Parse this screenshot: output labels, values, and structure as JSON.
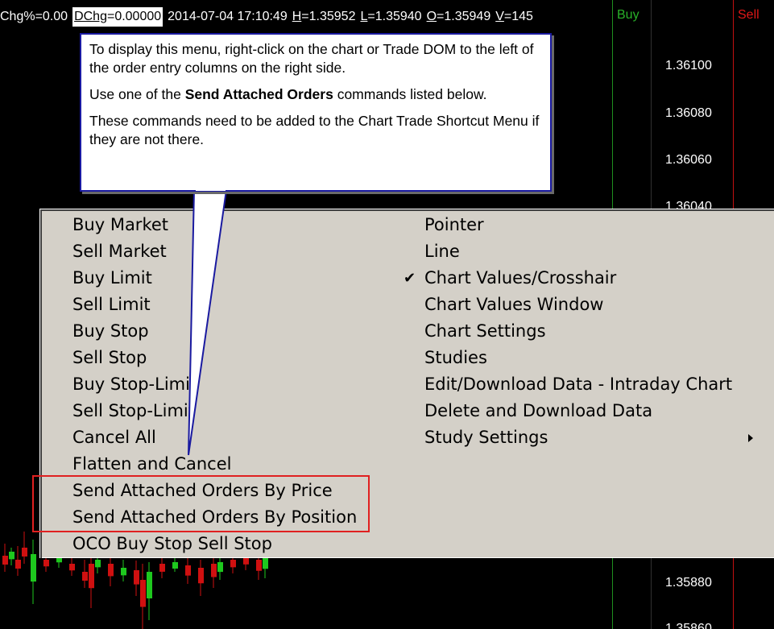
{
  "infobar": {
    "chg_pct": "Chg%=0.00",
    "dchg_label": "DChg",
    "dchg_value": "=0.00000",
    "datetime": "2014-07-04 17:10:49",
    "high_label": "H",
    "high_value": "=1.35952",
    "low_label": "L",
    "low_value": "=1.35940",
    "open_label": "O",
    "open_value": "=1.35949",
    "volume_label": "V",
    "volume_value": "=145"
  },
  "dom": {
    "buy_label": "Buy",
    "sell_label": "Sell",
    "prices": [
      "1.36100",
      "1.36080",
      "1.36060",
      "1.36040",
      "1.35880",
      "1.35860"
    ]
  },
  "callout": {
    "line1": "To display this menu, right-click on the chart or Trade DOM to the left of the order entry columns on the right side.",
    "line2_pre": "Use one of the ",
    "line2_bold": "Send Attached Orders",
    "line2_post": " commands listed below.",
    "line3": "These commands need to be added to the Chart Trade Shortcut Menu if they are not there."
  },
  "menu": {
    "left": [
      "Buy Market",
      "Sell Market",
      "Buy Limit",
      "Sell Limit",
      "Buy Stop",
      "Sell Stop",
      "Buy Stop-Limit",
      "Sell Stop-Limit",
      "Cancel All",
      "Flatten and Cancel",
      "Send Attached Orders By Price",
      "Send Attached Orders By Position",
      "OCO Buy Stop Sell Stop"
    ],
    "right": [
      "Pointer",
      "Line",
      "Chart Values/Crosshair",
      "Chart Values Window",
      "Chart Settings",
      "Studies",
      "Edit/Download Data - Intraday Chart",
      "Delete and Download Data",
      "Study Settings"
    ],
    "checked_item": "Chart Values/Crosshair",
    "check_mark": "✔"
  },
  "colors": {
    "menu_bg": "#d4d0c8",
    "callout_border": "#1a1aa0",
    "highlight": "#e02020",
    "buy": "#29b129",
    "sell": "#e01818",
    "candle_up": "#1ec81e",
    "candle_down": "#d01010"
  }
}
